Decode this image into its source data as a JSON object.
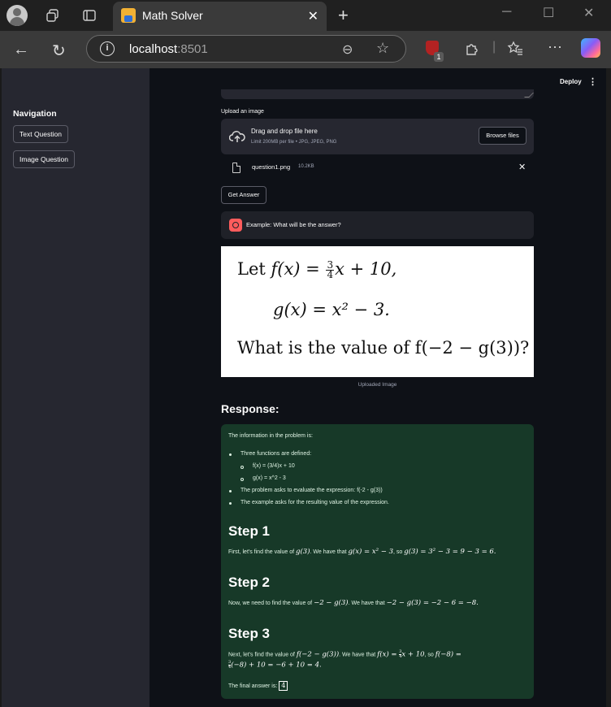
{
  "browser": {
    "tab_title": "Math Solver",
    "tab_close": "✕",
    "new_tab": "+",
    "url_host": "localhost",
    "url_port": ":8501",
    "extension_badge": "1"
  },
  "sidebar": {
    "title": "Navigation",
    "buttons": [
      "Text Question",
      "Image Question"
    ]
  },
  "header": {
    "deploy_label": "Deploy",
    "menu_icon": "⋮"
  },
  "uploader": {
    "label": "Upload an image",
    "dropzone_title": "Drag and drop file here",
    "dropzone_sub": "Limit 200MB per file • JPG, JPEG, PNG",
    "browse_label": "Browse files",
    "file_name": "question1.png",
    "file_size": "10.2KB",
    "remove_icon": "✕"
  },
  "get_answer_label": "Get Answer",
  "example": {
    "text": "Example: What will be the answer?"
  },
  "uploaded_image": {
    "caption": "Uploaded Image",
    "line1_prefix": "Let ",
    "line1_lhs": "f(x) = ",
    "line1_frac_num": "3",
    "line1_frac_den": "4",
    "line1_rest": "x + 10,",
    "line2": "g(x) = x² − 3.",
    "line3": "What is the value of f(−2 − g(3))?"
  },
  "response": {
    "heading": "Response:",
    "intro": "The information in the problem is:",
    "bullets": [
      "Three functions are defined:",
      "The problem asks to evaluate the expression: f(-2 - g(3))",
      "The example asks for the resulting value of the expression."
    ],
    "sub_bullets": [
      "f(x) = (3/4)x + 10",
      "g(x) = x^2 - 3"
    ],
    "step1_title": "Step 1",
    "step1_text_a": "First, let's find the value of ",
    "step1_math_a": "g(3)",
    "step1_text_b": ". We have that ",
    "step1_math_b": "g(x) = x² − 3",
    "step1_text_c": ", so ",
    "step1_math_c": "g(3) = 3² − 3 = 9 − 3 = 6.",
    "step2_title": "Step 2",
    "step2_text_a": "Now, we need to find the value of ",
    "step2_math_a": "−2 − g(3)",
    "step2_text_b": ". We have that ",
    "step2_math_b": "−2 − g(3) = −2 − 6 = −8.",
    "step3_title": "Step 3",
    "step3_text_a": "Next, let's find the value of ",
    "step3_math_a": "f(−2 − g(3))",
    "step3_text_b": ". We have that ",
    "step3_math_b_lhs": "f(x) = ",
    "step3_frac_num": "3",
    "step3_frac_den": "4",
    "step3_math_b_rest": "x + 10",
    "step3_text_c": ", so ",
    "step3_math_c": "f(−8) =",
    "step3_line2_rest": "(−8) + 10 = −6 + 10 = 4.",
    "final_text": "The final answer is: ",
    "final_value": "4"
  }
}
